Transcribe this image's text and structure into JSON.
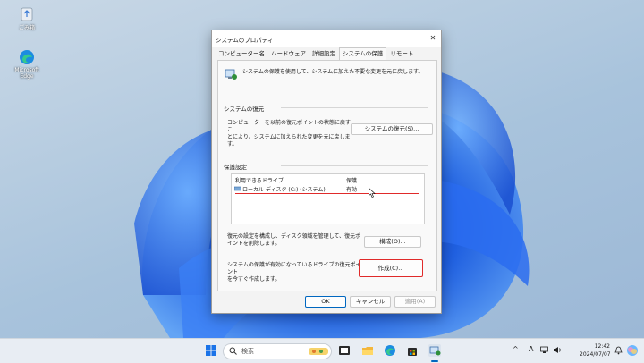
{
  "desktop": {
    "icons": [
      {
        "label": "ごみ箱"
      },
      {
        "label": "Microsoft Edge"
      }
    ]
  },
  "dialog": {
    "title": "システムのプロパティ",
    "close": "✕",
    "tabs": [
      "コンピューター名",
      "ハードウェア",
      "詳細設定",
      "システムの保護",
      "リモート"
    ],
    "header_text": "システムの保護を使用して、システムに加えた不要な変更を元に戻します。",
    "restore_group": {
      "label": "システムの復元",
      "description_lines": [
        "コンピューターを以前の復元ポイントの状態に戻すこ",
        "とにより、システムに加えられた変更を元に戻しま",
        "す。"
      ],
      "button": "システムの復元(S)..."
    },
    "protection_group": {
      "label": "保護設定",
      "columns": [
        "利用できるドライブ",
        "保護"
      ],
      "rows": [
        {
          "drive": "ローカル ディスク (C:) (システム)",
          "status": "有効"
        }
      ],
      "configure_lines": [
        "復元の設定を構成し、ディスク領域を管理して、復元ポ",
        "イントを削除します。"
      ],
      "configure_button": "構成(O)...",
      "create_lines": [
        "システムの保護が有効になっているドライブの復元ポイント",
        "を今すぐ作成します。"
      ],
      "create_button": "作成(C)..."
    },
    "footer": {
      "ok": "OK",
      "cancel": "キャンセル",
      "apply": "適用(A)"
    }
  },
  "taskbar": {
    "search_placeholder": "検索",
    "ime": "A",
    "time": "12:42",
    "date": "2024/07/07"
  },
  "colors": {
    "accent_red": "#e02a2a",
    "desktop_bloom": "#1f5fe0"
  }
}
